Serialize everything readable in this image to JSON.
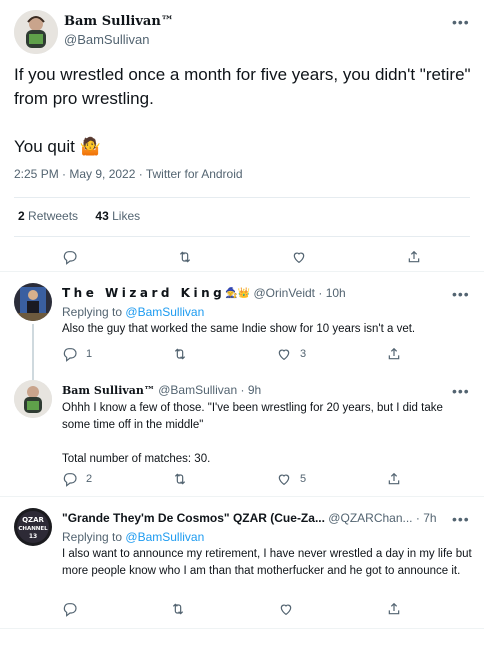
{
  "main_tweet": {
    "author_name": "Bam Sullivan™",
    "author_handle": "@BamSullivan",
    "text_line1": "If you wrestled once a month for five years, you didn't \"retire\" from pro wrestling.",
    "text_line2": "You quit 🤷",
    "timestamp": "2:25 PM · May 9, 2022 · Twitter for Android",
    "retweets_count": "2",
    "retweets_label": "Retweets",
    "likes_count": "43",
    "likes_label": "Likes",
    "more": "•••"
  },
  "replies": [
    {
      "name": "The Wizard King",
      "badges": "🧙👑",
      "handle": "@OrinVeidt",
      "time": "10h",
      "replying_prefix": "Replying to",
      "replying_to": "@BamSullivan",
      "text": [
        "Also the guy that worked the same Indie show for 10 years isn't a vet."
      ],
      "reply_count": "1",
      "retweet_count": "",
      "like_count": "3",
      "more": "•••"
    },
    {
      "name": "Bam Sullivan™",
      "handle": "@BamSullivan",
      "time": "9h",
      "text": [
        "Ohhh I know a few of those. \"I've been wrestling for 20 years, but I did take some time off in the middle\"",
        "Total number of matches: 30."
      ],
      "reply_count": "2",
      "retweet_count": "",
      "like_count": "5",
      "more": "•••"
    },
    {
      "name": "\"Grande They'm De Cosmos\" QZAR (Cue-Za...",
      "handle": "@QZARChan...",
      "time": "7h",
      "replying_prefix": "Replying to",
      "replying_to": "@BamSullivan",
      "text": [
        "I also want to announce my retirement, I have never wrestled a day in my life but more people know who I am than that motherfucker and he got to announce it."
      ],
      "reply_count": "",
      "retweet_count": "",
      "like_count": "",
      "more": "•••"
    }
  ],
  "avatar_texts": {
    "qzar": [
      "QZAR",
      "CHANNEL",
      "13"
    ]
  },
  "colors": {
    "link": "#1d9bf0",
    "secondary_text": "#536471",
    "divider": "#eff3f4"
  }
}
